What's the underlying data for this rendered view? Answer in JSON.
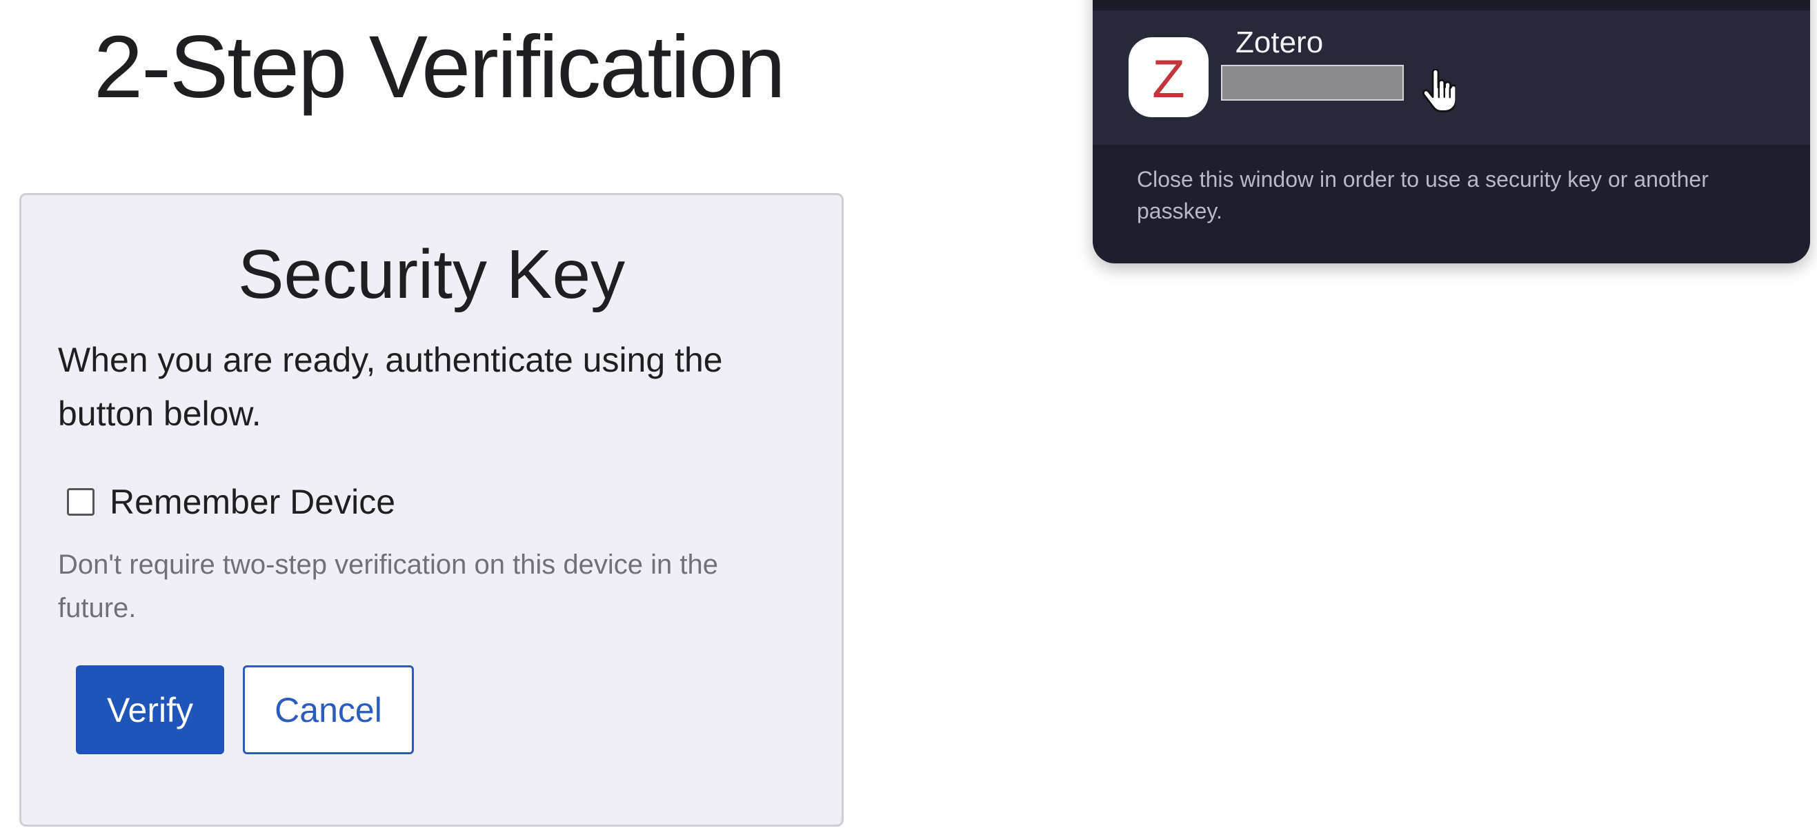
{
  "page": {
    "title": "2-Step Verification"
  },
  "security_key_card": {
    "title": "Security Key",
    "description": "When you are ready, authenticate using the button below.",
    "remember_device": {
      "label": "Remember Device",
      "checked": false,
      "hint": "Don't require two-step verification on this device in the future."
    },
    "buttons": {
      "verify_label": "Verify",
      "cancel_label": "Cancel"
    }
  },
  "passkey_popup": {
    "passkey": {
      "app_name": "Zotero",
      "icon_letter": "Z",
      "icon_name": "zotero-logo-icon",
      "account_redacted": true
    },
    "footer_text": "Close this window in order to use a security key or another passkey."
  },
  "colors": {
    "primary_button": "#1f54b9",
    "card_background": "#f0eff6",
    "popup_background": "#1e1f2c",
    "zotero_red": "#c1353b"
  },
  "cursor": {
    "type": "hand-pointer"
  }
}
